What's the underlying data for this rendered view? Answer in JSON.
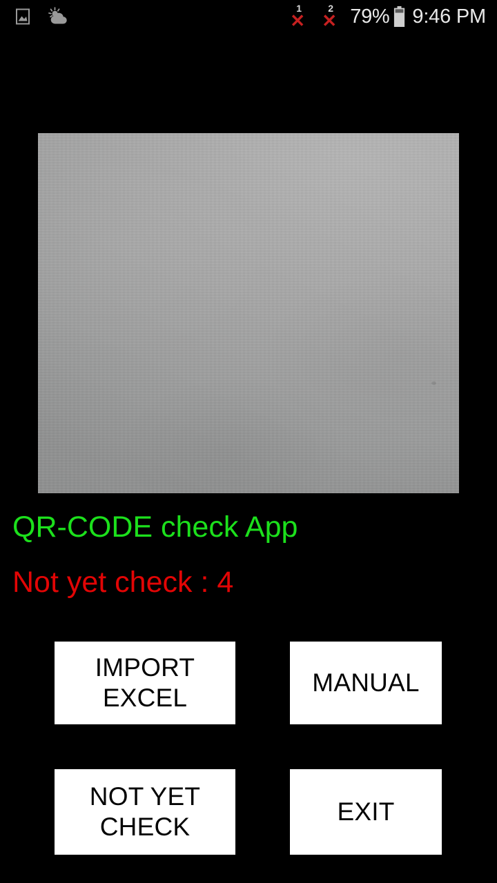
{
  "status_bar": {
    "left_icons": [
      {
        "name": "gallery-icon",
        "label": "Gallery"
      },
      {
        "name": "weather-icon",
        "label": "Weather"
      }
    ],
    "sim_indicators": [
      {
        "name": "sim-1-no-service-icon",
        "number": "1",
        "mark": "✕"
      },
      {
        "name": "sim-2-no-service-icon",
        "number": "2",
        "mark": "✕"
      }
    ],
    "battery_percent": "79%",
    "battery_icon": "battery-icon",
    "clock": "9:46 PM"
  },
  "camera": {
    "preview_label": "camera-preview"
  },
  "main": {
    "app_title": "QR-CODE check App",
    "status_count": "Not yet check : 4",
    "buttons": [
      {
        "id": "import-excel",
        "label": "IMPORT\nEXCEL"
      },
      {
        "id": "manual",
        "label": "MANUAL"
      },
      {
        "id": "not-yet-check",
        "label": "NOT YET\nCHECK"
      },
      {
        "id": "exit",
        "label": "EXIT"
      }
    ]
  },
  "colors": {
    "background": "#000000",
    "title_green": "#1CE01C",
    "status_red": "#E20505",
    "button_bg": "#FFFFFF",
    "button_text": "#040404",
    "status_text": "#E8E8E8",
    "sim_red": "#C62020",
    "preview_gray": "#A6A6A6"
  }
}
